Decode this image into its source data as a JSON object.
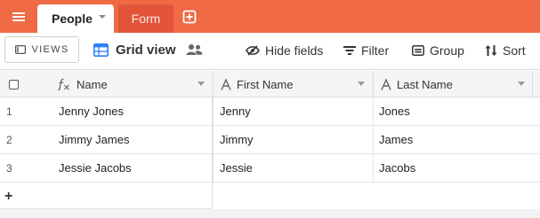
{
  "tabs": {
    "active_label": "People",
    "second_label": "Form"
  },
  "toolbar": {
    "views_label": "VIEWS",
    "view_name": "Grid view",
    "hide_fields_label": "Hide fields",
    "filter_label": "Filter",
    "group_label": "Group",
    "sort_label": "Sort"
  },
  "columns": {
    "name": "Name",
    "first_name": "First Name",
    "last_name": "Last Name"
  },
  "rows": [
    {
      "num": "1",
      "name": "Jenny Jones",
      "first": "Jenny",
      "last": "Jones"
    },
    {
      "num": "2",
      "name": "Jimmy James",
      "first": "Jimmy",
      "last": "James"
    },
    {
      "num": "3",
      "name": "Jessie Jacobs",
      "first": "Jessie",
      "last": "Jacobs"
    }
  ],
  "add_row_symbol": "+",
  "colors": {
    "topbar": "#ef6a45",
    "inactive_tab": "#e2553a",
    "grid_view_icon": "#2d7ff9"
  },
  "icons": {
    "menu": "hamburger-icon",
    "tab_caret": "caret-down-icon",
    "add_tab": "plus-square-icon",
    "views": "sidebar-panel-icon",
    "grid": "grid-view-icon",
    "collaborators": "people-icon",
    "hide": "eye-slash-icon",
    "filter": "filter-icon",
    "group": "group-icon",
    "sort": "sort-icon",
    "formula": "formula-icon",
    "text_field": "text-field-icon"
  }
}
